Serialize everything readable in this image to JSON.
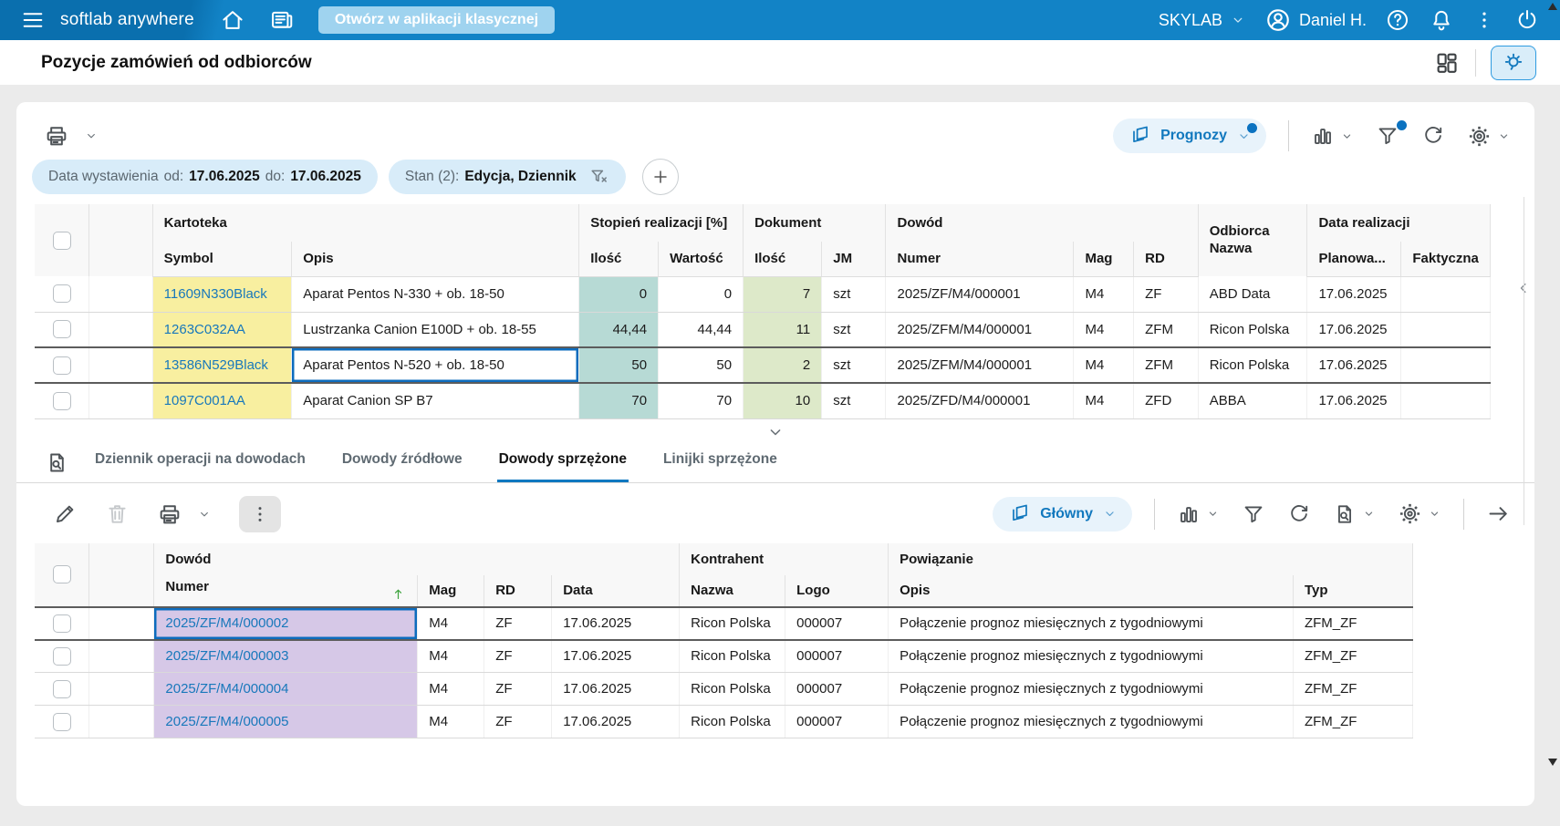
{
  "topbar": {
    "brand": "softlab anywhere",
    "open_classic": "Otwórz w aplikacji klasycznej",
    "company": "SKYLAB",
    "user": "Daniel H."
  },
  "page_title": "Pozycje zamówień od odbiorców",
  "filters": {
    "date_label": "Data wystawienia",
    "from_label": "od:",
    "from_value": "17.06.2025",
    "to_label": "do:",
    "to_value": "17.06.2025",
    "state_label": "Stan (2):",
    "state_value": "Edycja, Dziennik"
  },
  "top_toolbar": {
    "view_label": "Prognozy"
  },
  "bottom_toolbar": {
    "view_label": "Główny"
  },
  "orders_table": {
    "groups": {
      "kartoteka": "Kartoteka",
      "stopien": "Stopień realizacji [%]",
      "dokument": "Dokument",
      "dowod": "Dowód",
      "odbiorca_line1": "Odbiorca",
      "odbiorca_line2": "Nazwa",
      "data_realizacji": "Data realizacji"
    },
    "columns": {
      "symbol": "Symbol",
      "opis": "Opis",
      "ilosc_real": "Ilość",
      "wartosc_real": "Wartość",
      "ilosc_dok": "Ilość",
      "jm": "JM",
      "numer": "Numer",
      "mag": "Mag",
      "rd": "RD",
      "planowana": "Planowa...",
      "faktyczna": "Faktyczna"
    },
    "rows": [
      {
        "symbol": "11609N330Black",
        "opis": "Aparat Pentos N-330 + ob. 18-50",
        "ilosc_real": "0",
        "wartosc_real": "0",
        "ilosc_dok": "7",
        "jm": "szt",
        "numer": "2025/ZF/M4/000001",
        "mag": "M4",
        "rd": "ZF",
        "odbiorca": "ABD Data",
        "planowana": "17.06.2025",
        "faktyczna": ""
      },
      {
        "symbol": "1263C032AA",
        "opis": "Lustrzanka Canion E100D + ob. 18-55",
        "ilosc_real": "44,44",
        "wartosc_real": "44,44",
        "ilosc_dok": "11",
        "jm": "szt",
        "numer": "2025/ZFM/M4/000001",
        "mag": "M4",
        "rd": "ZFM",
        "odbiorca": "Ricon Polska",
        "planowana": "17.06.2025",
        "faktyczna": ""
      },
      {
        "symbol": "13586N529Black",
        "opis": "Aparat Pentos N-520 + ob. 18-50",
        "ilosc_real": "50",
        "wartosc_real": "50",
        "ilosc_dok": "2",
        "jm": "szt",
        "numer": "2025/ZFM/M4/000001",
        "mag": "M4",
        "rd": "ZFM",
        "odbiorca": "Ricon Polska",
        "planowana": "17.06.2025",
        "faktyczna": ""
      },
      {
        "symbol": "1097C001AA",
        "opis": "Aparat Canion SP B7",
        "ilosc_real": "70",
        "wartosc_real": "70",
        "ilosc_dok": "10",
        "jm": "szt",
        "numer": "2025/ZFD/M4/000001",
        "mag": "M4",
        "rd": "ZFD",
        "odbiorca": "ABBA",
        "planowana": "17.06.2025",
        "faktyczna": ""
      }
    ]
  },
  "tabs": {
    "items": [
      "Dziennik operacji na dowodach",
      "Dowody źródłowe",
      "Dowody sprzężone",
      "Linijki sprzężone"
    ],
    "active_index": 2
  },
  "linked_table": {
    "groups": {
      "dowod": "Dowód",
      "kontrahent": "Kontrahent",
      "powiazanie": "Powiązanie"
    },
    "columns": {
      "numer": "Numer",
      "mag": "Mag",
      "rd": "RD",
      "data": "Data",
      "nazwa": "Nazwa",
      "logo": "Logo",
      "opis": "Opis",
      "typ": "Typ"
    },
    "rows": [
      {
        "numer": "2025/ZF/M4/000002",
        "mag": "M4",
        "rd": "ZF",
        "data": "17.06.2025",
        "nazwa": "Ricon Polska",
        "logo": "000007",
        "opis": "Połączenie prognoz miesięcznych z tygodniowymi",
        "typ": "ZFM_ZF"
      },
      {
        "numer": "2025/ZF/M4/000003",
        "mag": "M4",
        "rd": "ZF",
        "data": "17.06.2025",
        "nazwa": "Ricon Polska",
        "logo": "000007",
        "opis": "Połączenie prognoz miesięcznych z tygodniowymi",
        "typ": "ZFM_ZF"
      },
      {
        "numer": "2025/ZF/M4/000004",
        "mag": "M4",
        "rd": "ZF",
        "data": "17.06.2025",
        "nazwa": "Ricon Polska",
        "logo": "000007",
        "opis": "Połączenie prognoz miesięcznych z tygodniowymi",
        "typ": "ZFM_ZF"
      },
      {
        "numer": "2025/ZF/M4/000005",
        "mag": "M4",
        "rd": "ZF",
        "data": "17.06.2025",
        "nazwa": "Ricon Polska",
        "logo": "000007",
        "opis": "Połączenie prognoz miesięcznych z tygodniowymi",
        "typ": "ZFM_ZF"
      }
    ]
  },
  "colors": {
    "topbar_blue": "#1283c6",
    "accent_blue": "#0f78c0",
    "symbol_bg": "#f8efa0",
    "realization_bg": "#b7dad5",
    "document_qty_bg": "#dde9c9",
    "linked_number_bg": "#d6c8e7",
    "chip_bg": "#d8ecf9"
  }
}
